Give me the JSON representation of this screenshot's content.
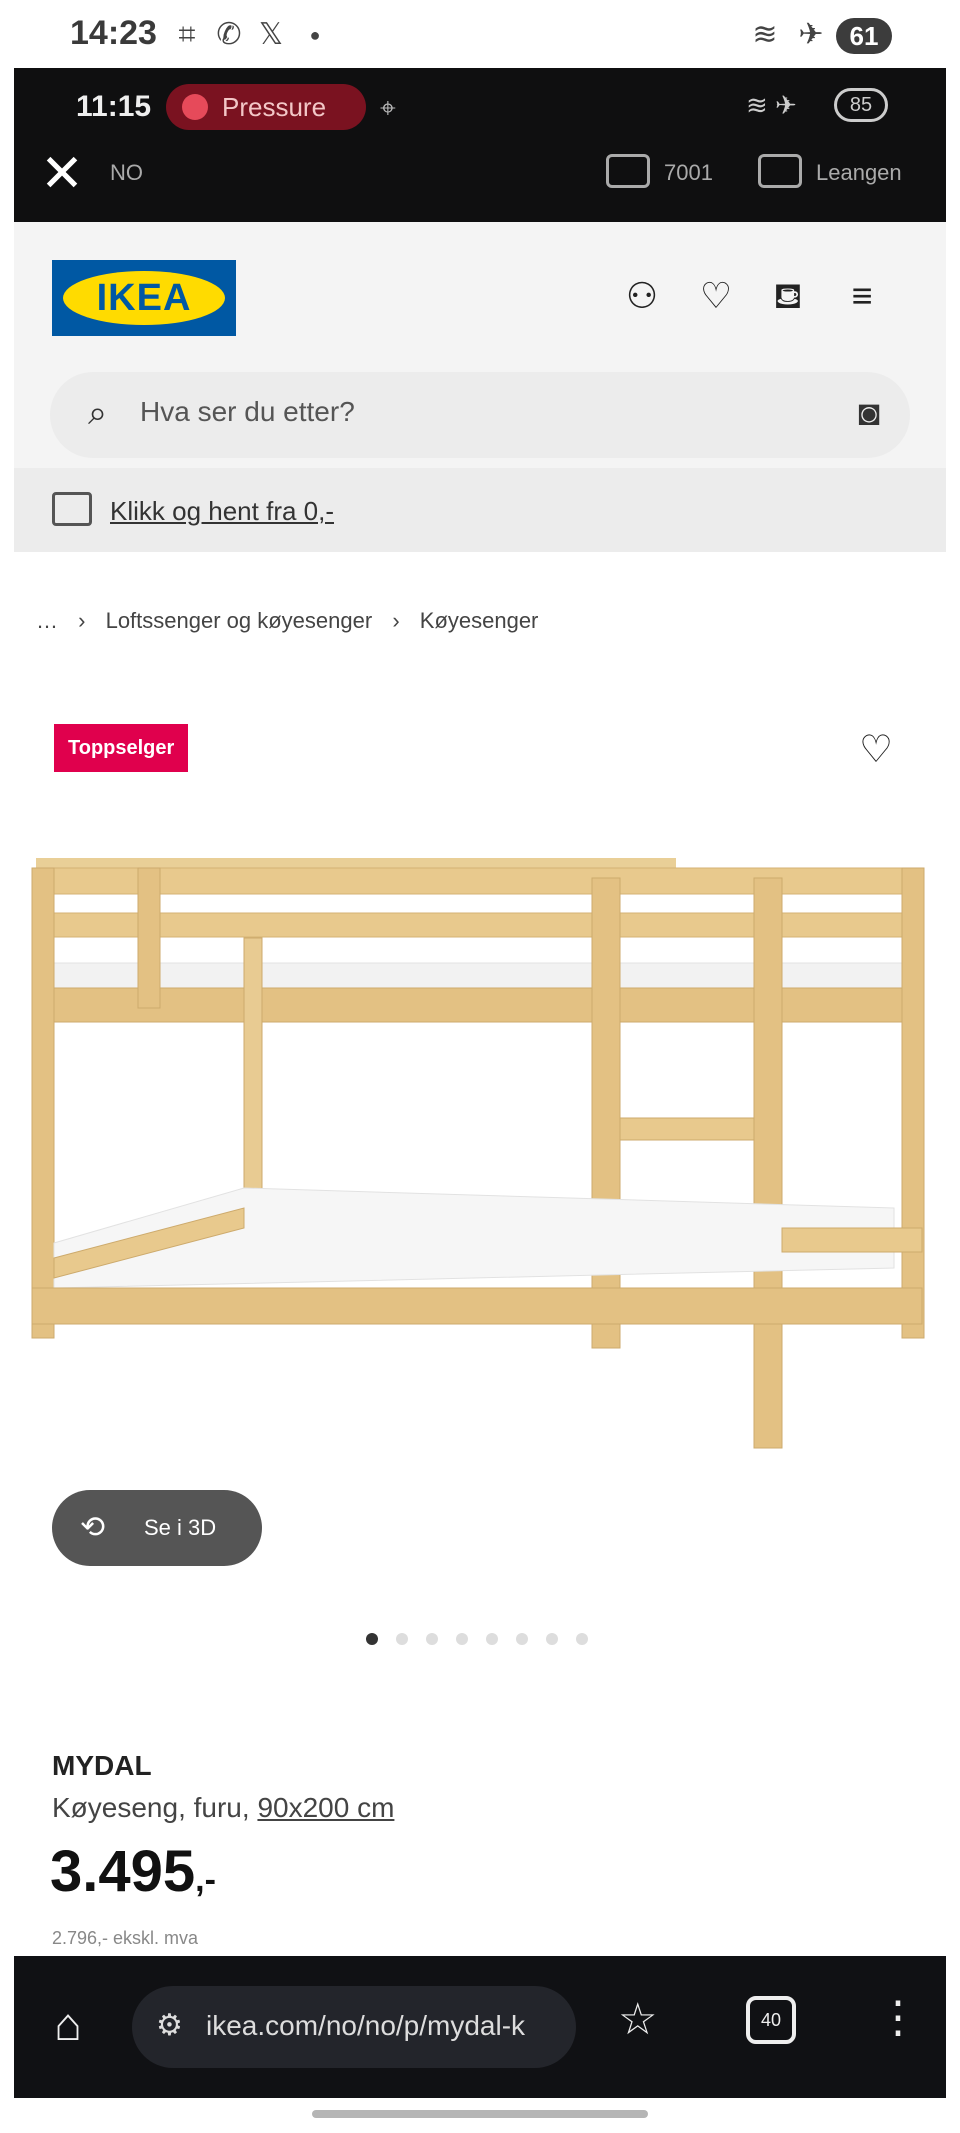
{
  "outer_status": {
    "time": "14:23",
    "battery": "61"
  },
  "inner_status": {
    "time": "11:15",
    "pressure_label": "Pressure",
    "battery": "85"
  },
  "promo_bar": {
    "left_text": "NO",
    "delivery_text": "7001",
    "store_text": "Leangen"
  },
  "header": {
    "logo_text": "IKEA",
    "search_placeholder": "Hva ser du etter?"
  },
  "click_collect": {
    "label": "Klikk og hent fra 0,-"
  },
  "breadcrumb": {
    "items": [
      "…",
      "Loftssenger og køyesenger",
      "Køyesenger"
    ]
  },
  "product": {
    "badge": "Toppselger",
    "view_3d_label": "Se i 3D",
    "name": "MYDAL",
    "description": "Køyeseng, furu,",
    "size": "90x200 cm",
    "price": "3.495",
    "price_suffix": ",-",
    "vat_note": "2.796,- ekskl. mva",
    "image_count": 8,
    "active_image": 1
  },
  "browser": {
    "url": "ikea.com/no/no/p/mydal-k",
    "tab_count": "40"
  },
  "colors": {
    "ikea_blue": "#0058a3",
    "ikea_yellow": "#ffdb00",
    "badge_red": "#e0004d",
    "wood": "#e8c98d"
  }
}
